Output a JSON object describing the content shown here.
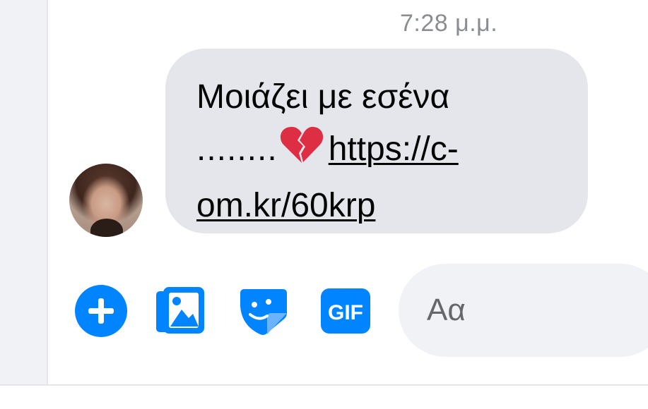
{
  "conversation": {
    "timestamp": "7:28 μ.μ.",
    "message": {
      "line1": "Μοιάζει με εσένα",
      "dots": "........",
      "emoji": "broken-heart",
      "link_part1": "https://c-",
      "link_part2": "om.kr/60krp"
    },
    "sender_avatar": "profile-photo"
  },
  "composer": {
    "actions": [
      {
        "icon": "plus-circle-icon"
      },
      {
        "icon": "photo-gallery-icon"
      },
      {
        "icon": "sticker-icon"
      },
      {
        "icon": "gif-icon",
        "label": "GIF"
      }
    ],
    "input_placeholder": "Αα"
  },
  "colors": {
    "accent": "#0084ff",
    "bubble": "#e4e6eb",
    "timestamp": "#8a8d91",
    "heart": "#dd2e44"
  }
}
